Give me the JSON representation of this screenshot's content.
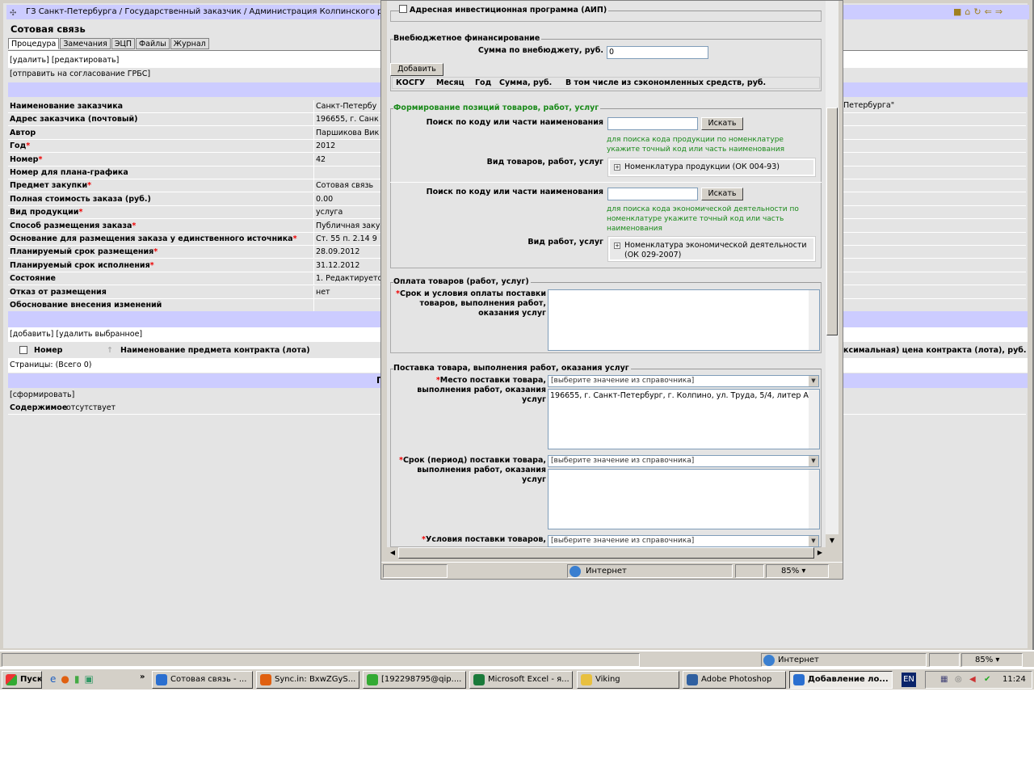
{
  "page": {
    "breadcrumb": "ГЗ Санкт-Петербурга / Государственный заказчик / Администрация Колпинского района",
    "title": "Сотовая связь",
    "tabs": [
      "Процедура",
      "Замечания",
      "ЭЦП",
      "Файлы",
      "Журнал"
    ],
    "actions": {
      "delete": "[удалить]",
      "edit": "[редактировать]",
      "send": "[отправить на согласование ГРБС]"
    },
    "fields": [
      {
        "label": "Наименование заказчика",
        "required": false,
        "value": "Санкт-Петербу",
        "value_right": "Петербурга\""
      },
      {
        "label": "Адрес заказчика (почтовый)",
        "required": false,
        "value": "196655, г. Санк"
      },
      {
        "label": "Автор",
        "required": false,
        "value": "Паршикова Вик"
      },
      {
        "label": "Год",
        "required": true,
        "value": "2012"
      },
      {
        "label": "Номер",
        "required": true,
        "value": "42"
      },
      {
        "label": "Номер для плана-графика",
        "required": false,
        "value": ""
      },
      {
        "label": "Предмет закупки",
        "required": true,
        "value": "Сотовая связь"
      },
      {
        "label": "Полная стоимость заказа (руб.)",
        "required": false,
        "value": "0.00"
      },
      {
        "label": "Вид продукции",
        "required": true,
        "value": "услуга"
      },
      {
        "label": "Способ размещения заказа",
        "required": true,
        "value": "Публичная заку"
      },
      {
        "label": "Основание для размещения заказа у единственного источника",
        "required": true,
        "value": "Ст. 55 п. 2.14 9"
      },
      {
        "label": "Планируемый срок размещения",
        "required": true,
        "value": "28.09.2012"
      },
      {
        "label": "Планируемый срок исполнения",
        "required": true,
        "value": "31.12.2012"
      },
      {
        "label": "Состояние",
        "required": false,
        "value": "1. Редактируетс"
      },
      {
        "label": "Отказ от размещения",
        "required": false,
        "value": "нет"
      },
      {
        "label": "Обоснование внесения изменений",
        "required": false,
        "value": ""
      }
    ],
    "lots": {
      "add": "[добавить]",
      "delete_selected": "[удалить выбранное]",
      "col_number": "Номер",
      "col_name": "Наименование предмета контракта (лота)",
      "col_price": "ксимальная) цена контракта (лота), руб.",
      "pages": "Страницы:  (Всего 0)",
      "band_letter": "Г"
    },
    "generate": "[сформировать]",
    "content_label": "Содержимое",
    "content_value": "отсутствует"
  },
  "popup": {
    "aip_label": "Адресная инвестиционная программа (АИП)",
    "offbudget": {
      "legend": "Внебюджетное финансирование",
      "sum_label": "Сумма по внебюджету, руб.",
      "sum_value": "0",
      "add_button": "Добавить",
      "columns": [
        "КОСГУ",
        "Месяц",
        "Год",
        "Сумма, руб.",
        "В том числе из сэкономленных средств, руб."
      ]
    },
    "positions": {
      "legend": "Формирование позиций товаров, работ, услуг",
      "search_label": "Поиск по коду или части наименования",
      "search_button": "Искать",
      "hint1": "для поиска кода продукции по номенклатуре укажите точный код или часть наименования",
      "goods_label": "Вид товаров, работ, услуг",
      "goods_tree": "Номенклатура продукции (ОК 004-93)",
      "hint2": "для поиска кода экономической деятельности по номенклатуре укажите точный код или часть наименования",
      "works_label": "Вид работ, услуг",
      "works_tree": "Номенклатура экономической деятельности (ОК 029-2007)"
    },
    "payment": {
      "legend": "Оплата товаров (работ, услуг)",
      "terms_label": "Срок и условия оплаты поставки товаров, выполнения работ, оказания услуг",
      "terms_value": ""
    },
    "delivery": {
      "legend": "Поставка товара, выполнения работ, оказания услуг",
      "place_label": "Место поставки товара, выполнения работ, оказания услуг",
      "select_placeholder": "[выберите значение из справочника]",
      "place_value": "196655, г. Санкт-Петербург, г. Колпино, ул. Труда, 5/4, литер А",
      "period_label": "Срок (период) поставки товара, выполнения работ, оказания услуг",
      "conditions_label": "Условия поставки товаров,"
    },
    "status": {
      "zone": "Интернет",
      "zoom": "85%"
    }
  },
  "browser_status": {
    "zone": "Интернет",
    "zoom": "85%"
  },
  "taskbar": {
    "start": "Пуск",
    "items": [
      "Сотовая связь - ...",
      "Sync.in: BxwZGyS...",
      "[192298795@qip....",
      "Microsoft Excel - я...",
      "Viking",
      "Adobe Photoshop",
      "Добавление ло..."
    ],
    "lang": "EN",
    "clock": "11:24"
  }
}
